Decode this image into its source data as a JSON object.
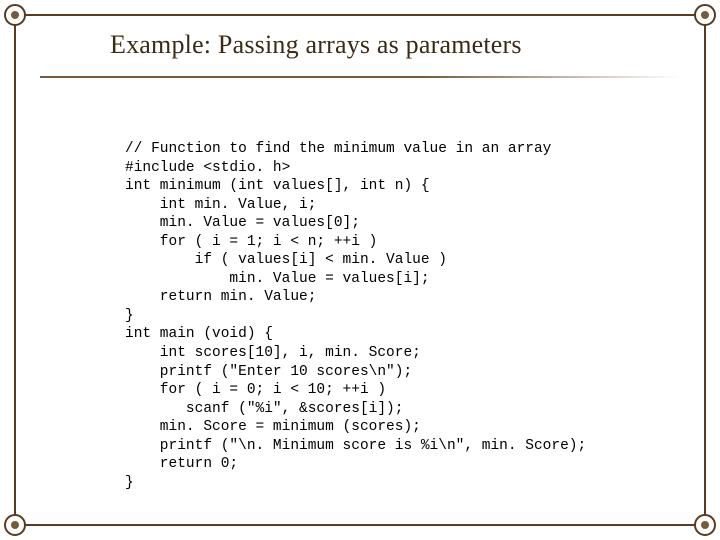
{
  "title": "Example: Passing arrays as parameters",
  "code_lines": [
    "// Function to find the minimum value in an array",
    "#include <stdio. h>",
    "int minimum (int values[], int n) {",
    "    int min. Value, i;",
    "    min. Value = values[0];",
    "    for ( i = 1; i < n; ++i )",
    "        if ( values[i] < min. Value )",
    "            min. Value = values[i];",
    "    return min. Value;",
    "}",
    "int main (void) {",
    "    int scores[10], i, min. Score;",
    "    printf (\"Enter 10 scores\\n\");",
    "    for ( i = 0; i < 10; ++i )",
    "       scanf (\"%i\", &scores[i]);",
    "    min. Score = minimum (scores);",
    "    printf (\"\\n. Minimum score is %i\\n\", min. Score);",
    "    return 0;",
    "}"
  ]
}
